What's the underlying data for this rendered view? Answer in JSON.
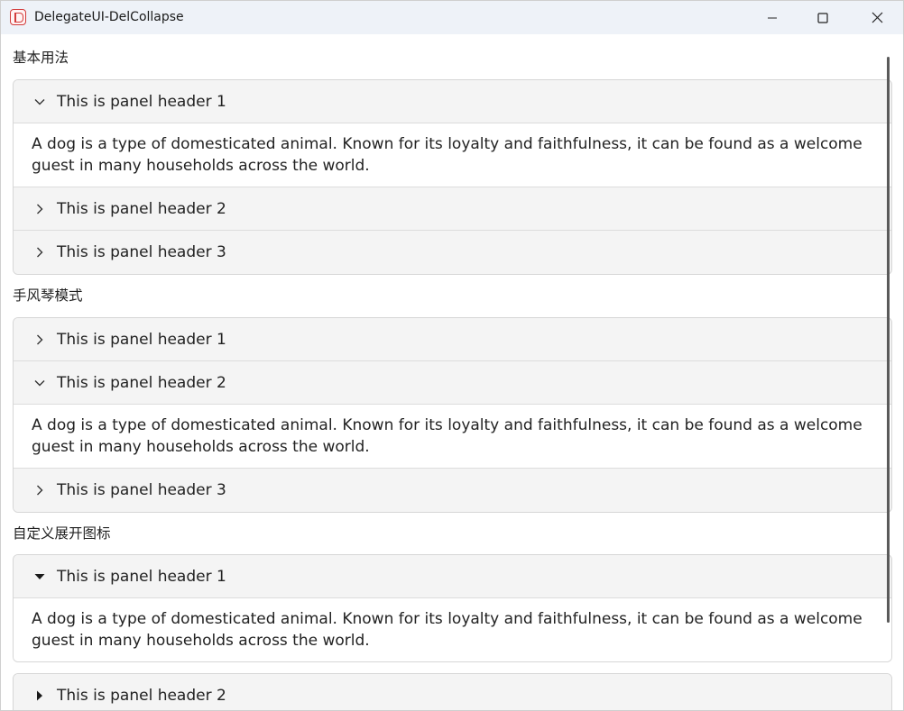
{
  "window": {
    "title": "DelegateUI-DelCollapse"
  },
  "sections": [
    {
      "title": "基本用法",
      "panels": [
        {
          "header": "This is panel header 1",
          "expanded": true,
          "icon": "chevron-down-icon",
          "body": "A dog is a type of domesticated animal. Known for its loyalty and faithfulness, it can be found as a welcome guest in many households across the world."
        },
        {
          "header": "This is panel header 2",
          "expanded": false,
          "icon": "chevron-right-icon"
        },
        {
          "header": "This is panel header 3",
          "expanded": false,
          "icon": "chevron-right-icon"
        }
      ]
    },
    {
      "title": "手风琴模式",
      "panels": [
        {
          "header": "This is panel header 1",
          "expanded": false,
          "icon": "chevron-right-icon"
        },
        {
          "header": "This is panel header 2",
          "expanded": true,
          "icon": "chevron-down-icon",
          "body": "A dog is a type of domesticated animal. Known for its loyalty and faithfulness, it can be found as a welcome guest in many households across the world."
        },
        {
          "header": "This is panel header 3",
          "expanded": false,
          "icon": "chevron-right-icon"
        }
      ]
    },
    {
      "title": "自定义展开图标",
      "panels": [
        {
          "header": "This is panel header 1",
          "expanded": true,
          "icon": "caret-down-icon",
          "body": "A dog is a type of domesticated animal. Known for its loyalty and faithfulness, it can be found as a welcome guest in many households across the world."
        },
        {
          "header": "This is panel header 2",
          "expanded": false,
          "icon": "caret-right-icon"
        }
      ]
    }
  ],
  "colors": {
    "titlebar_bg": "#eef2f8",
    "header_bg": "#f4f4f4",
    "border": "#d6d6d6",
    "app_icon": "#d23b3b"
  }
}
